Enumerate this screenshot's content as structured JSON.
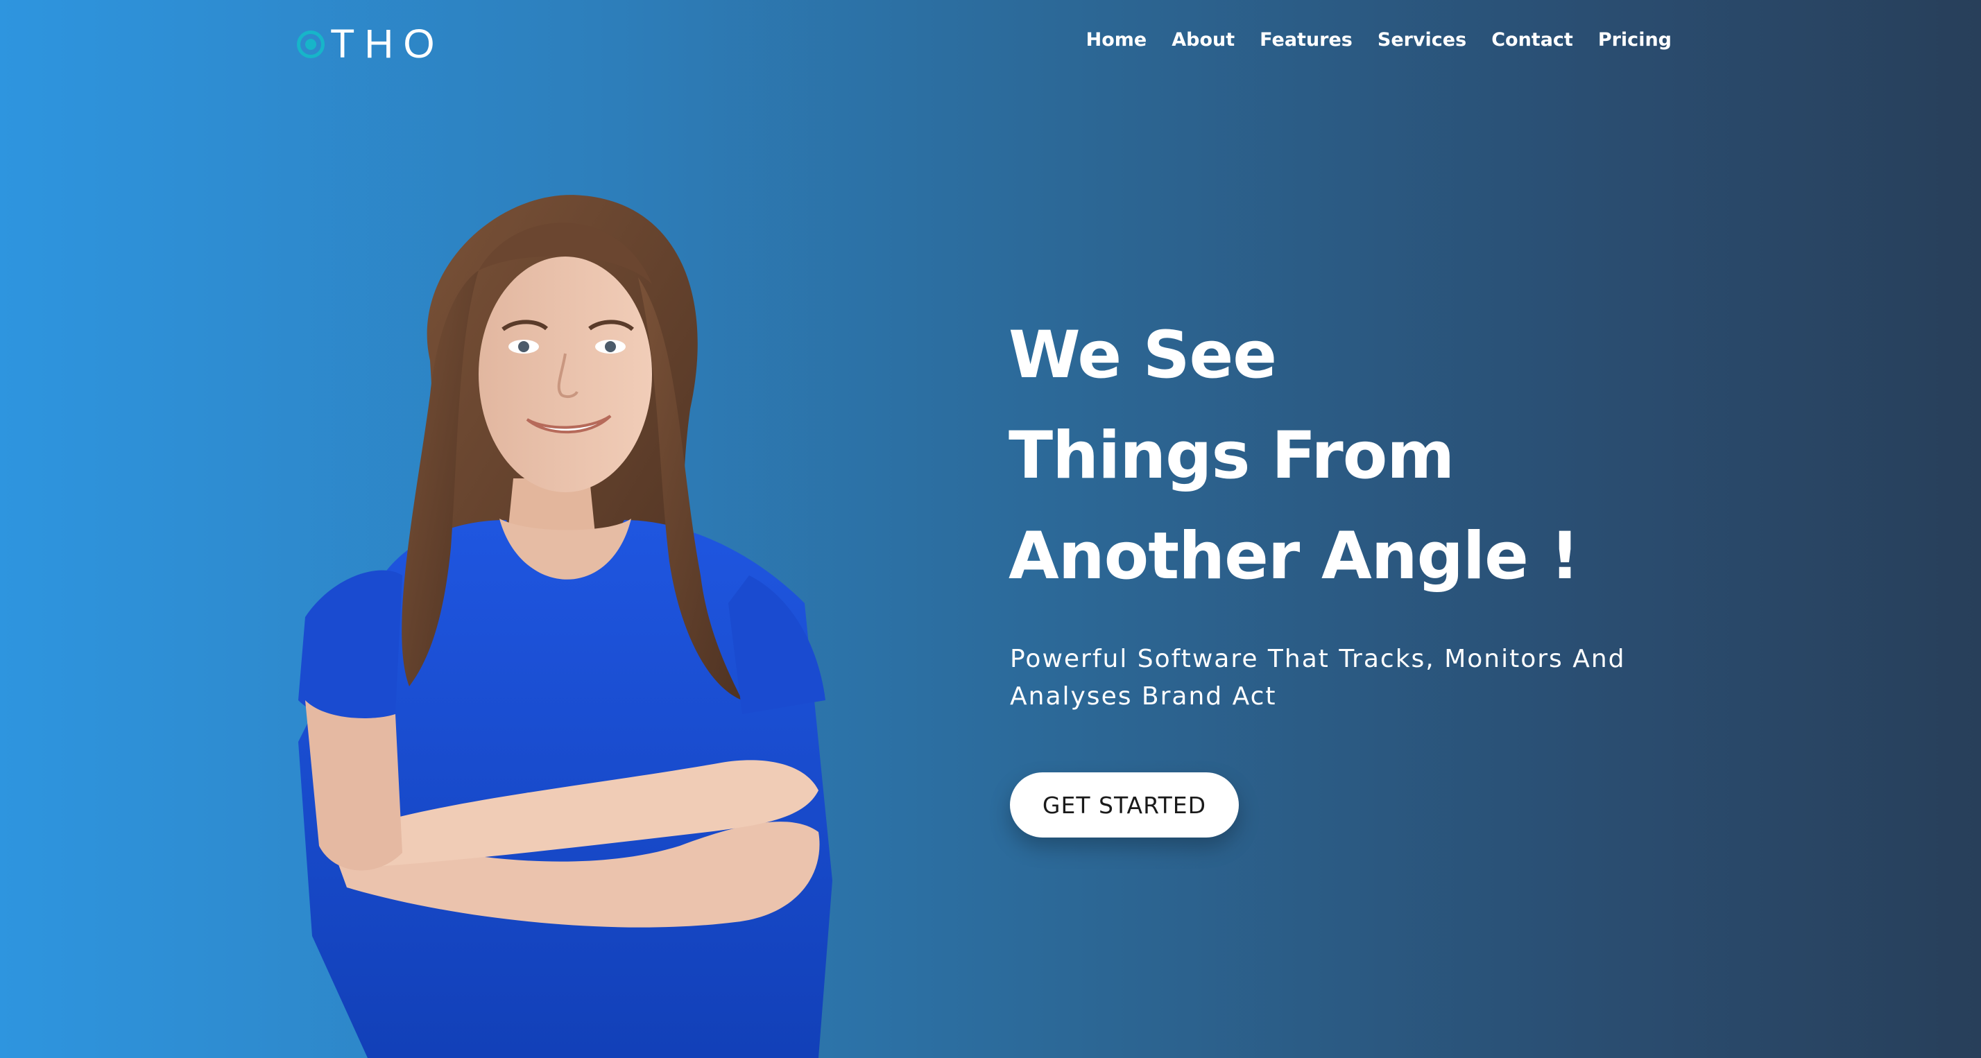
{
  "brand": {
    "logo_text": "THO",
    "logo_mark_color": "#17b5c9"
  },
  "nav": {
    "items": [
      {
        "label": "Home"
      },
      {
        "label": "About"
      },
      {
        "label": "Features"
      },
      {
        "label": "Services"
      },
      {
        "label": "Contact"
      },
      {
        "label": "Pricing"
      }
    ]
  },
  "hero": {
    "headline_lines": [
      "We See",
      "Things From",
      "Another Angle !"
    ],
    "subtitle": "Powerful Software That Tracks, Monitors And Analyses Brand Act",
    "cta_label": "GET STARTED",
    "image": "smiling-woman-arms-crossed-blue-shirt"
  },
  "colors": {
    "background_left": "#2e95df",
    "background_right": "#283f5a",
    "text": "#ffffff",
    "shirt": "#1a4fd6"
  }
}
